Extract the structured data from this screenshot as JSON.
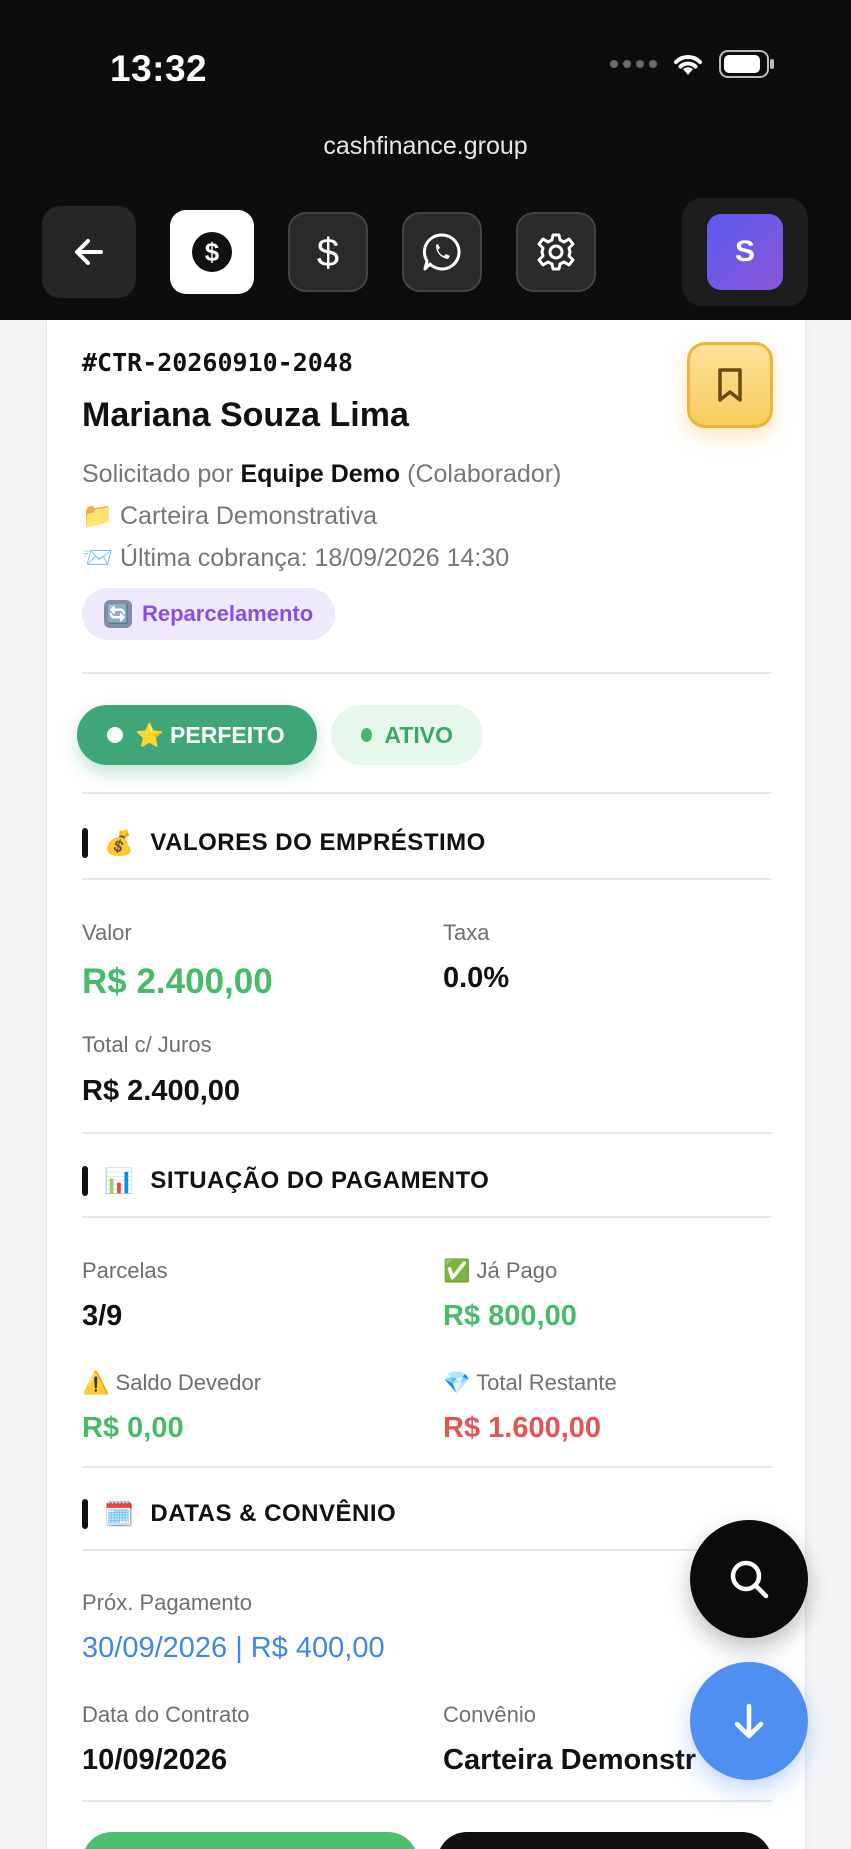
{
  "status_bar": {
    "time": "13:32"
  },
  "browser": {
    "url": "cashfinance.group"
  },
  "toolbar": {
    "avatar_initial": "S",
    "icons": [
      "back-arrow-icon",
      "dollar-circle-icon",
      "dollar-icon",
      "whatsapp-icon",
      "gear-icon"
    ]
  },
  "contract": {
    "id": "#CTR-20260910-2048",
    "client_name": "Mariana Souza Lima",
    "requested_prefix": "Solicitado por",
    "requested_by": "Equipe Demo",
    "requested_role": "(Colaborador)",
    "portfolio_emoji": "📁",
    "portfolio": "Carteira Demonstrativa",
    "last_charge_emoji": "📨",
    "last_charge": "Última cobrança: 18/09/2026 14:30",
    "tag_emoji": "🔄",
    "tag": "Reparcelamento"
  },
  "badges": {
    "perfeito": "⭐ PERFEITO",
    "ativo": "ATIVO"
  },
  "loan_values": {
    "emoji": "💰",
    "title": "VALORES DO EMPRÉSTIMO",
    "valor_label": "Valor",
    "valor": "R$ 2.400,00",
    "taxa_label": "Taxa",
    "taxa": "0.0%",
    "total_label": "Total c/ Juros",
    "total": "R$ 2.400,00"
  },
  "payment_status": {
    "emoji": "📊",
    "title": "SITUAÇÃO DO PAGAMENTO",
    "parcelas_label": "Parcelas",
    "parcelas": "3/9",
    "pago_emoji": "✅",
    "pago_label": "Já Pago",
    "pago": "R$ 800,00",
    "saldo_emoji": "⚠️",
    "saldo_label": "Saldo Devedor",
    "saldo": "R$ 0,00",
    "restante_emoji": "💎",
    "restante_label": "Total Restante",
    "restante": "R$ 1.600,00"
  },
  "dates": {
    "emoji": "🗓️",
    "title": "DATAS & CONVÊNIO",
    "prox_label": "Próx. Pagamento",
    "prox": "30/09/2026 | R$ 400,00",
    "data_label": "Data do Contrato",
    "data": "10/09/2026",
    "convenio_label": "Convênio",
    "convenio": "Carteira Demonstr"
  },
  "colors": {
    "green": "#49bb68",
    "red": "#e25555",
    "blue": "#3f86e6",
    "purple": "#8a4fe0",
    "gold": "#f7cc5c"
  }
}
